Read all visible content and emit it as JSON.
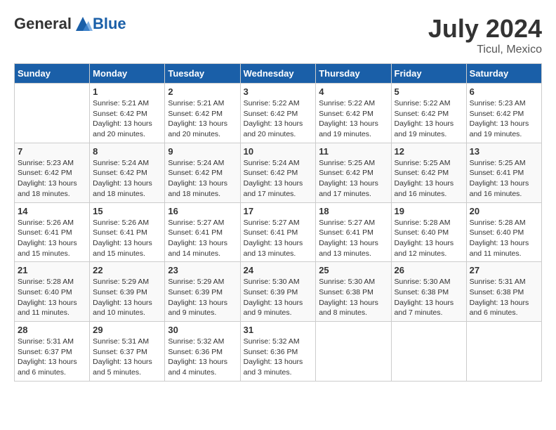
{
  "header": {
    "logo_general": "General",
    "logo_blue": "Blue",
    "month_year": "July 2024",
    "location": "Ticul, Mexico"
  },
  "days_of_week": [
    "Sunday",
    "Monday",
    "Tuesday",
    "Wednesday",
    "Thursday",
    "Friday",
    "Saturday"
  ],
  "weeks": [
    [
      {
        "day": "",
        "info": ""
      },
      {
        "day": "1",
        "info": "Sunrise: 5:21 AM\nSunset: 6:42 PM\nDaylight: 13 hours\nand 20 minutes."
      },
      {
        "day": "2",
        "info": "Sunrise: 5:21 AM\nSunset: 6:42 PM\nDaylight: 13 hours\nand 20 minutes."
      },
      {
        "day": "3",
        "info": "Sunrise: 5:22 AM\nSunset: 6:42 PM\nDaylight: 13 hours\nand 20 minutes."
      },
      {
        "day": "4",
        "info": "Sunrise: 5:22 AM\nSunset: 6:42 PM\nDaylight: 13 hours\nand 19 minutes."
      },
      {
        "day": "5",
        "info": "Sunrise: 5:22 AM\nSunset: 6:42 PM\nDaylight: 13 hours\nand 19 minutes."
      },
      {
        "day": "6",
        "info": "Sunrise: 5:23 AM\nSunset: 6:42 PM\nDaylight: 13 hours\nand 19 minutes."
      }
    ],
    [
      {
        "day": "7",
        "info": "Sunrise: 5:23 AM\nSunset: 6:42 PM\nDaylight: 13 hours\nand 18 minutes."
      },
      {
        "day": "8",
        "info": "Sunrise: 5:24 AM\nSunset: 6:42 PM\nDaylight: 13 hours\nand 18 minutes."
      },
      {
        "day": "9",
        "info": "Sunrise: 5:24 AM\nSunset: 6:42 PM\nDaylight: 13 hours\nand 18 minutes."
      },
      {
        "day": "10",
        "info": "Sunrise: 5:24 AM\nSunset: 6:42 PM\nDaylight: 13 hours\nand 17 minutes."
      },
      {
        "day": "11",
        "info": "Sunrise: 5:25 AM\nSunset: 6:42 PM\nDaylight: 13 hours\nand 17 minutes."
      },
      {
        "day": "12",
        "info": "Sunrise: 5:25 AM\nSunset: 6:42 PM\nDaylight: 13 hours\nand 16 minutes."
      },
      {
        "day": "13",
        "info": "Sunrise: 5:25 AM\nSunset: 6:41 PM\nDaylight: 13 hours\nand 16 minutes."
      }
    ],
    [
      {
        "day": "14",
        "info": "Sunrise: 5:26 AM\nSunset: 6:41 PM\nDaylight: 13 hours\nand 15 minutes."
      },
      {
        "day": "15",
        "info": "Sunrise: 5:26 AM\nSunset: 6:41 PM\nDaylight: 13 hours\nand 15 minutes."
      },
      {
        "day": "16",
        "info": "Sunrise: 5:27 AM\nSunset: 6:41 PM\nDaylight: 13 hours\nand 14 minutes."
      },
      {
        "day": "17",
        "info": "Sunrise: 5:27 AM\nSunset: 6:41 PM\nDaylight: 13 hours\nand 13 minutes."
      },
      {
        "day": "18",
        "info": "Sunrise: 5:27 AM\nSunset: 6:41 PM\nDaylight: 13 hours\nand 13 minutes."
      },
      {
        "day": "19",
        "info": "Sunrise: 5:28 AM\nSunset: 6:40 PM\nDaylight: 13 hours\nand 12 minutes."
      },
      {
        "day": "20",
        "info": "Sunrise: 5:28 AM\nSunset: 6:40 PM\nDaylight: 13 hours\nand 11 minutes."
      }
    ],
    [
      {
        "day": "21",
        "info": "Sunrise: 5:28 AM\nSunset: 6:40 PM\nDaylight: 13 hours\nand 11 minutes."
      },
      {
        "day": "22",
        "info": "Sunrise: 5:29 AM\nSunset: 6:39 PM\nDaylight: 13 hours\nand 10 minutes."
      },
      {
        "day": "23",
        "info": "Sunrise: 5:29 AM\nSunset: 6:39 PM\nDaylight: 13 hours\nand 9 minutes."
      },
      {
        "day": "24",
        "info": "Sunrise: 5:30 AM\nSunset: 6:39 PM\nDaylight: 13 hours\nand 9 minutes."
      },
      {
        "day": "25",
        "info": "Sunrise: 5:30 AM\nSunset: 6:38 PM\nDaylight: 13 hours\nand 8 minutes."
      },
      {
        "day": "26",
        "info": "Sunrise: 5:30 AM\nSunset: 6:38 PM\nDaylight: 13 hours\nand 7 minutes."
      },
      {
        "day": "27",
        "info": "Sunrise: 5:31 AM\nSunset: 6:38 PM\nDaylight: 13 hours\nand 6 minutes."
      }
    ],
    [
      {
        "day": "28",
        "info": "Sunrise: 5:31 AM\nSunset: 6:37 PM\nDaylight: 13 hours\nand 6 minutes."
      },
      {
        "day": "29",
        "info": "Sunrise: 5:31 AM\nSunset: 6:37 PM\nDaylight: 13 hours\nand 5 minutes."
      },
      {
        "day": "30",
        "info": "Sunrise: 5:32 AM\nSunset: 6:36 PM\nDaylight: 13 hours\nand 4 minutes."
      },
      {
        "day": "31",
        "info": "Sunrise: 5:32 AM\nSunset: 6:36 PM\nDaylight: 13 hours\nand 3 minutes."
      },
      {
        "day": "",
        "info": ""
      },
      {
        "day": "",
        "info": ""
      },
      {
        "day": "",
        "info": ""
      }
    ]
  ]
}
